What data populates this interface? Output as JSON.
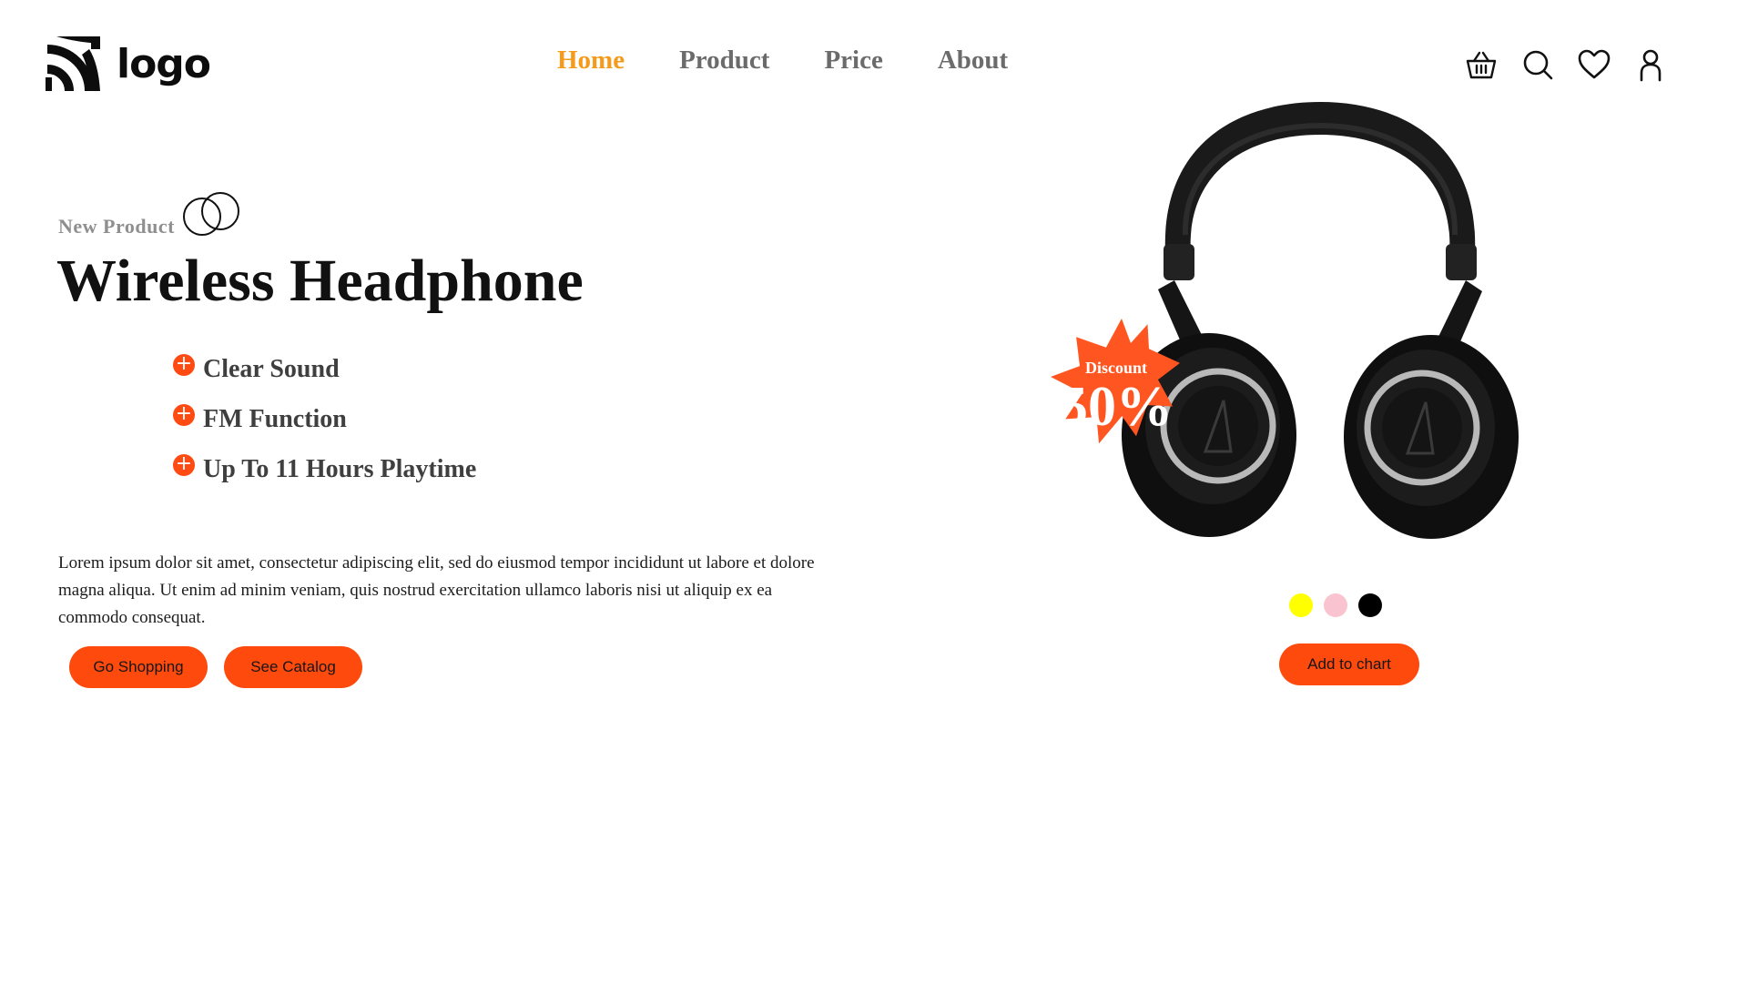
{
  "header": {
    "logo_text": "logo",
    "nav": [
      {
        "label": "Home",
        "active": true
      },
      {
        "label": "Product",
        "active": false
      },
      {
        "label": "Price",
        "active": false
      },
      {
        "label": "About",
        "active": false
      }
    ],
    "icons": [
      "basket-icon",
      "search-icon",
      "heart-icon",
      "user-icon"
    ]
  },
  "hero": {
    "eyebrow": "New Product",
    "title": "Wireless Headphone",
    "features": [
      "Clear Sound",
      "FM Function",
      "Up To 11 Hours Playtime"
    ],
    "description": "Lorem ipsum dolor sit amet, consectetur adipiscing elit, sed do eiusmod tempor incididunt ut labore et dolore magna aliqua. Ut enim ad minim veniam, quis nostrud exercitation ullamco laboris nisi ut aliquip ex ea commodo consequat.",
    "buttons": {
      "shop": "Go Shopping",
      "catalog": "See Catalog"
    }
  },
  "product": {
    "discount_label": "Discount",
    "discount_value": "50%",
    "colors": [
      "#ffff00",
      "#f9c3d0",
      "#000000"
    ],
    "cart_button": "Add to chart"
  },
  "theme": {
    "accent": "#ff4a0d",
    "nav_active": "#f59a1b"
  }
}
